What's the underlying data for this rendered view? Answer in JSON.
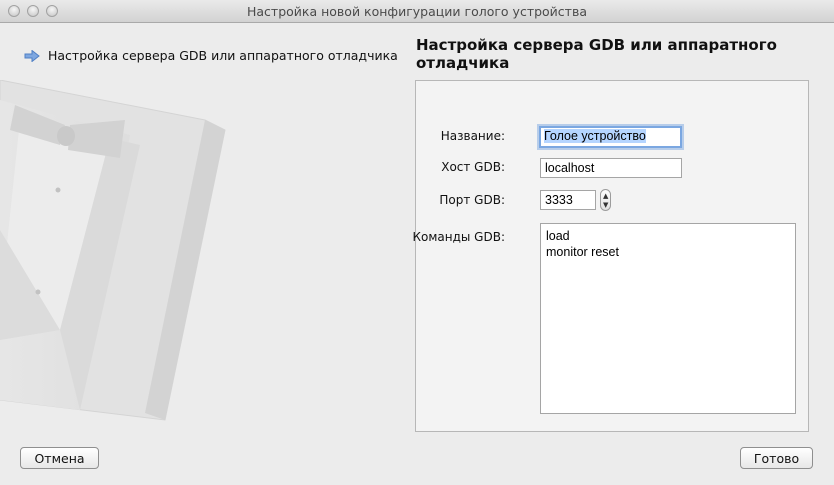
{
  "window": {
    "title": "Настройка новой конфигурации голого устройства"
  },
  "sidebar": {
    "steps": [
      {
        "label": "Настройка сервера GDB или аппаратного отладчика",
        "active": true
      }
    ]
  },
  "page": {
    "heading": "Настройка сервера GDB или аппаратного отладчика"
  },
  "form": {
    "name_label": "Название:",
    "name_value": "Голое устройство",
    "host_label": "Хост GDB:",
    "host_value": "localhost",
    "port_label": "Порт GDB:",
    "port_value": "3333",
    "commands_label": "Команды GDB:",
    "commands_lines": [
      "load",
      "monitor reset"
    ]
  },
  "buttons": {
    "cancel": "Отмена",
    "done": "Готово"
  },
  "icons": {
    "step_arrow": "arrow-right-icon",
    "art": "tuxedo-bowtie-illustration"
  },
  "colors": {
    "accent": "#7ba7e1",
    "selection": "#b5d5ff",
    "arrow": "#5d8fd6"
  }
}
